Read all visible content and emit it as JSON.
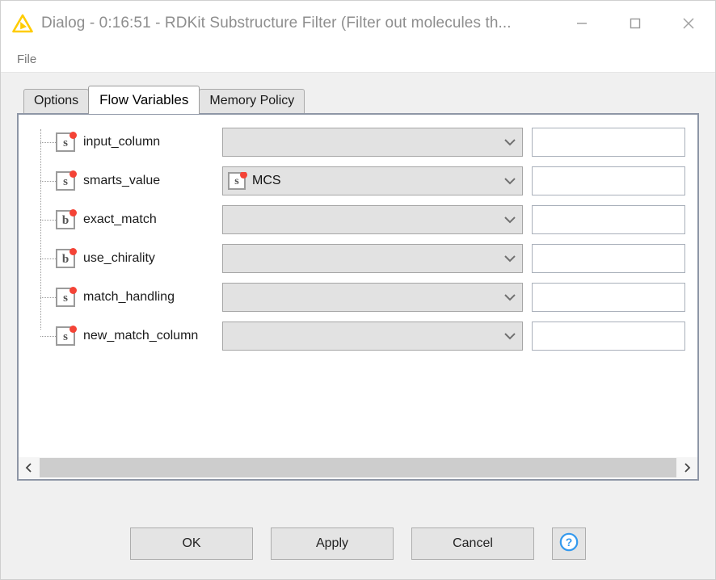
{
  "window": {
    "title": "Dialog - 0:16:51 - RDKit Substructure Filter (Filter out molecules th...",
    "logo_name": "knime-logo-icon",
    "controls": {
      "minimize": "minimize-icon",
      "maximize": "maximize-icon",
      "close": "close-icon"
    }
  },
  "menubar": {
    "items": [
      {
        "label": "File"
      }
    ]
  },
  "tabs": [
    {
      "label": "Options",
      "selected": false
    },
    {
      "label": "Flow Variables",
      "selected": true
    },
    {
      "label": "Memory Policy",
      "selected": false
    }
  ],
  "flow_variables": {
    "rows": [
      {
        "name": "input_column",
        "type": "s",
        "combo_value": "",
        "combo_icon": false,
        "text_value": ""
      },
      {
        "name": "smarts_value",
        "type": "s",
        "combo_value": "MCS",
        "combo_icon": true,
        "combo_icon_type": "s",
        "text_value": ""
      },
      {
        "name": "exact_match",
        "type": "b",
        "combo_value": "",
        "combo_icon": false,
        "text_value": ""
      },
      {
        "name": "use_chirality",
        "type": "b",
        "combo_value": "",
        "combo_icon": false,
        "text_value": ""
      },
      {
        "name": "match_handling",
        "type": "s",
        "combo_value": "",
        "combo_icon": false,
        "text_value": ""
      },
      {
        "name": "new_match_column",
        "type": "s",
        "combo_value": "",
        "combo_icon": false,
        "text_value": ""
      }
    ]
  },
  "scrollbar": {
    "left_arrow": "chevron-left-icon",
    "right_arrow": "chevron-right-icon"
  },
  "footer": {
    "ok": "OK",
    "apply": "Apply",
    "cancel": "Cancel",
    "help": "help-icon"
  },
  "colors": {
    "accent_yellow": "#FFCC00",
    "flag_red": "#F44336",
    "help_blue": "#3399EE",
    "panel_border": "#8E96A6"
  }
}
